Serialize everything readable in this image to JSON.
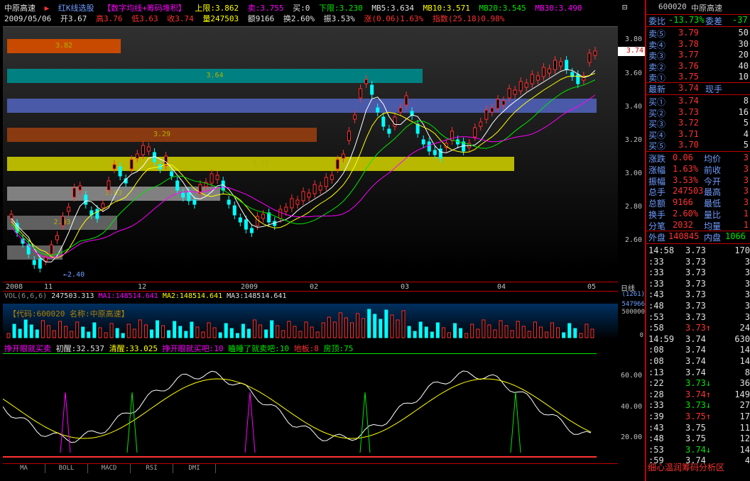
{
  "header": {
    "stock_name": "中原高速",
    "indicator_name": "红K线选股",
    "indicator_desc": "【数字均线+筹码堆积】",
    "upper_label": "上限:3.862",
    "sell_label": "卖:3.755",
    "buy_label": "买:0",
    "lower_label": "下限:3.230",
    "mb5": "MB5:3.634",
    "mb10": "MB10:3.571",
    "mb20": "MB20:3.545",
    "mb30": "MB30:3.490",
    "date": "2009/05/06",
    "open": "开3.67",
    "high": "高3.76",
    "low": "低3.63",
    "close": "收3.74",
    "volume": "量247503",
    "amount": "额9166",
    "turnover": "换2.60%",
    "amplitude": "振3.53%",
    "change": "涨(0.06)1.63%",
    "index": "指数(25.18)0.98%"
  },
  "price_axis": [
    "3.80",
    "3.60",
    "3.40",
    "3.20",
    "3.00",
    "2.80",
    "2.60"
  ],
  "current_price_tag": "3.74",
  "date_axis": [
    "2008",
    "11",
    "12",
    "2009",
    "02",
    "03",
    "04",
    "05"
  ],
  "period_label": "日线",
  "low_marker": "2.40",
  "bands": [
    {
      "label": "3.82",
      "color": "#c84a00"
    },
    {
      "label": "3.64",
      "color": "#008080"
    },
    {
      "label": "",
      "color": "#4a5aa8"
    },
    {
      "label": "3.29",
      "color": "#8a3a10"
    },
    {
      "label": "3.11",
      "color": "#b8b800"
    },
    {
      "label": "3.03",
      "color": "#808080"
    },
    {
      "label": "2.93",
      "color": "#606060"
    },
    {
      "label": "",
      "color": "#606060"
    }
  ],
  "volume": {
    "header": "VOL(6,6,6)",
    "vol_value": "247503.313",
    "ma1": "MA1:148514.641",
    "ma2": "MA2:148514.641",
    "ma3": "MA3:148514.641",
    "code_text": "【代码:600020 名称:中原高速】",
    "axis_top": "(1261)",
    "axis_mid": "547966",
    "axis_low": "500000",
    "axis_zero": "0"
  },
  "indicator": {
    "name": "挣开眼就买卖",
    "wake": "初醒:32.537",
    "clear": "清醒:33.025",
    "buy_text": "挣开眼就买吧:10",
    "sell_text": "瞌睡了就卖吧:10",
    "floor": "地板:8",
    "roof": "房顶:75",
    "axis": [
      "60.00",
      "40.00",
      "20.00"
    ]
  },
  "tabs": [
    "MA",
    "BOLL",
    "MACD",
    "RSI",
    "DMI"
  ],
  "quote": {
    "code": "600020",
    "name": "中原高速",
    "weibi_label": "委比",
    "weibi": "-13.73%",
    "weicha_label": "委差",
    "weicha": "-37",
    "sells": [
      {
        "label": "卖⑤",
        "price": "3.79",
        "vol": "50"
      },
      {
        "label": "卖④",
        "price": "3.78",
        "vol": "30"
      },
      {
        "label": "卖③",
        "price": "3.77",
        "vol": "20"
      },
      {
        "label": "卖②",
        "price": "3.76",
        "vol": "40"
      },
      {
        "label": "卖①",
        "price": "3.75",
        "vol": "10"
      }
    ],
    "latest_label": "最新",
    "latest": "3.74",
    "spot_label": "现手",
    "buys": [
      {
        "label": "买①",
        "price": "3.74",
        "vol": "8"
      },
      {
        "label": "买②",
        "price": "3.73",
        "vol": "16"
      },
      {
        "label": "买③",
        "price": "3.72",
        "vol": "5"
      },
      {
        "label": "买④",
        "price": "3.71",
        "vol": "4"
      },
      {
        "label": "买⑤",
        "price": "3.70",
        "vol": "5"
      }
    ],
    "stats": [
      {
        "l1": "涨跌",
        "v1": "0.06",
        "l2": "均价",
        "v2": "3"
      },
      {
        "l1": "涨幅",
        "v1": "1.63%",
        "l2": "前收",
        "v2": "3"
      },
      {
        "l1": "振幅",
        "v1": "3.53%",
        "l2": "今开",
        "v2": "3"
      },
      {
        "l1": "总手",
        "v1": "247503",
        "l2": "最高",
        "v2": "3"
      },
      {
        "l1": "总额",
        "v1": "9166",
        "l2": "最低",
        "v2": "3"
      },
      {
        "l1": "换手",
        "v1": "2.60%",
        "l2": "量比",
        "v2": "1"
      },
      {
        "l1": "分笔",
        "v1": "2032",
        "l2": "均量",
        "v2": "1"
      }
    ],
    "outer_label": "外盘",
    "outer": "140845",
    "inner_label": "内盘",
    "inner": "1066"
  },
  "ticks": [
    {
      "t": "14:58",
      "p": "3.73",
      "v": "170",
      "c": "wht"
    },
    {
      "t": ":33",
      "p": "3.73",
      "v": "3",
      "c": "wht"
    },
    {
      "t": ":33",
      "p": "3.73",
      "v": "3",
      "c": "wht"
    },
    {
      "t": ":33",
      "p": "3.73",
      "v": "3",
      "c": "wht"
    },
    {
      "t": ":43",
      "p": "3.73",
      "v": "3",
      "c": "wht"
    },
    {
      "t": ":48",
      "p": "3.73",
      "v": "3",
      "c": "wht"
    },
    {
      "t": ":53",
      "p": "3.73",
      "v": "3",
      "c": "wht"
    },
    {
      "t": ":58",
      "p": "3.73↑",
      "v": "24",
      "c": "red"
    },
    {
      "t": "14:59",
      "p": "3.74",
      "v": "630",
      "c": "wht"
    },
    {
      "t": ":08",
      "p": "3.74",
      "v": "14",
      "c": "wht"
    },
    {
      "t": ":08",
      "p": "3.74",
      "v": "14",
      "c": "wht"
    },
    {
      "t": ":13",
      "p": "3.74",
      "v": "8",
      "c": "wht"
    },
    {
      "t": ":22",
      "p": "3.73↓",
      "v": "36",
      "c": "grn"
    },
    {
      "t": ":28",
      "p": "3.74↑",
      "v": "149",
      "c": "red"
    },
    {
      "t": ":33",
      "p": "3.73↓",
      "v": "27",
      "c": "grn"
    },
    {
      "t": ":39",
      "p": "3.75↑",
      "v": "17",
      "c": "red"
    },
    {
      "t": ":43",
      "p": "3.75",
      "v": "11",
      "c": "wht"
    },
    {
      "t": ":48",
      "p": "3.75",
      "v": "12",
      "c": "wht"
    },
    {
      "t": ":53",
      "p": "3.74↓",
      "v": "14",
      "c": "grn"
    },
    {
      "t": ":59",
      "p": "3.74",
      "v": "4",
      "c": "wht"
    }
  ],
  "footer_text": "细心温润筹码分析区",
  "colors": {
    "up": "#ff3232",
    "down": "#00ffff",
    "accent": "#c00000"
  }
}
